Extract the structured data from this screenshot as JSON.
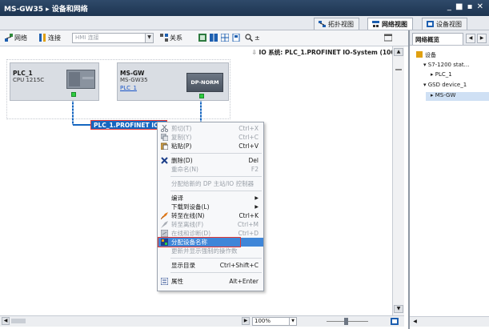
{
  "window": {
    "title": "MS-GW35 ▸ 设备和网络",
    "controls": "_ ■ ▪ ✕"
  },
  "view_tabs": {
    "topology": "拓扑视图",
    "network": "网络视图",
    "device": "设备视图"
  },
  "toolbar": {
    "network": "网络",
    "connections": "连接",
    "hmi_placeholder": "HMI 连接",
    "relations": "关系",
    "zoom": "±"
  },
  "canvas": {
    "io_system": "IO 系统: PLC_1.PROFINET IO-System (100)",
    "devices": [
      {
        "name": "PLC_1",
        "type": "CPU 1215C"
      },
      {
        "name": "MS-GW",
        "type": "MS-GW35",
        "link": "PLC_1",
        "module": "DP-NORM"
      }
    ],
    "network_label": "PLC_1.PROFINET IO-..."
  },
  "context_menu": {
    "items": [
      {
        "label": "剪切(T)",
        "shortcut": "Ctrl+X",
        "disabled": true,
        "icon": "scissors-icon"
      },
      {
        "label": "复制(Y)",
        "shortcut": "Ctrl+C",
        "disabled": true,
        "icon": "copy-icon"
      },
      {
        "label": "粘贴(P)",
        "shortcut": "Ctrl+V",
        "disabled": false,
        "icon": "paste-icon"
      },
      {
        "label": "删除(D)",
        "shortcut": "Del",
        "disabled": false,
        "icon": "delete-icon"
      },
      {
        "label": "重命名(N)",
        "shortcut": "F2",
        "disabled": true,
        "icon": ""
      },
      {
        "label": "分配给新的 DP 主站/IO 控制器",
        "shortcut": "",
        "disabled": true,
        "icon": ""
      },
      {
        "label": "编译",
        "shortcut": "",
        "disabled": false,
        "icon": "",
        "submenu": true
      },
      {
        "label": "下载到设备(L)",
        "shortcut": "",
        "disabled": false,
        "icon": "",
        "submenu": true
      },
      {
        "label": "转至在线(N)",
        "shortcut": "Ctrl+K",
        "disabled": false,
        "icon": "go-online-icon"
      },
      {
        "label": "转至离线(F)",
        "shortcut": "Ctrl+M",
        "disabled": true,
        "icon": "go-offline-icon"
      },
      {
        "label": "在线和诊断(D)",
        "shortcut": "Ctrl+D",
        "disabled": true,
        "icon": "diagnostics-icon"
      },
      {
        "label": "分配设备名称",
        "shortcut": "",
        "disabled": false,
        "highlighted": true,
        "icon": "assign-name-icon"
      },
      {
        "label": "更新并显示强制的操作数",
        "shortcut": "",
        "disabled": true,
        "icon": ""
      },
      {
        "label": "显示目录",
        "shortcut": "Ctrl+Shift+C",
        "disabled": false,
        "icon": ""
      },
      {
        "label": "属性",
        "shortcut": "Alt+Enter",
        "disabled": false,
        "icon": "properties-icon"
      }
    ]
  },
  "bottom_bar": {
    "zoom": "100%"
  },
  "right_panel": {
    "tab_label": "网络概览",
    "tree": [
      "设备",
      "S7-1200 stat...",
      "PLC_1",
      "GSD device_1",
      "MS-GW"
    ]
  },
  "colors": {
    "title_bar": "#1d3450",
    "network": "#1566c0",
    "highlight": "#3f86d8",
    "emphasis_box": "#e53935",
    "profinet_green": "#2ecc40"
  }
}
